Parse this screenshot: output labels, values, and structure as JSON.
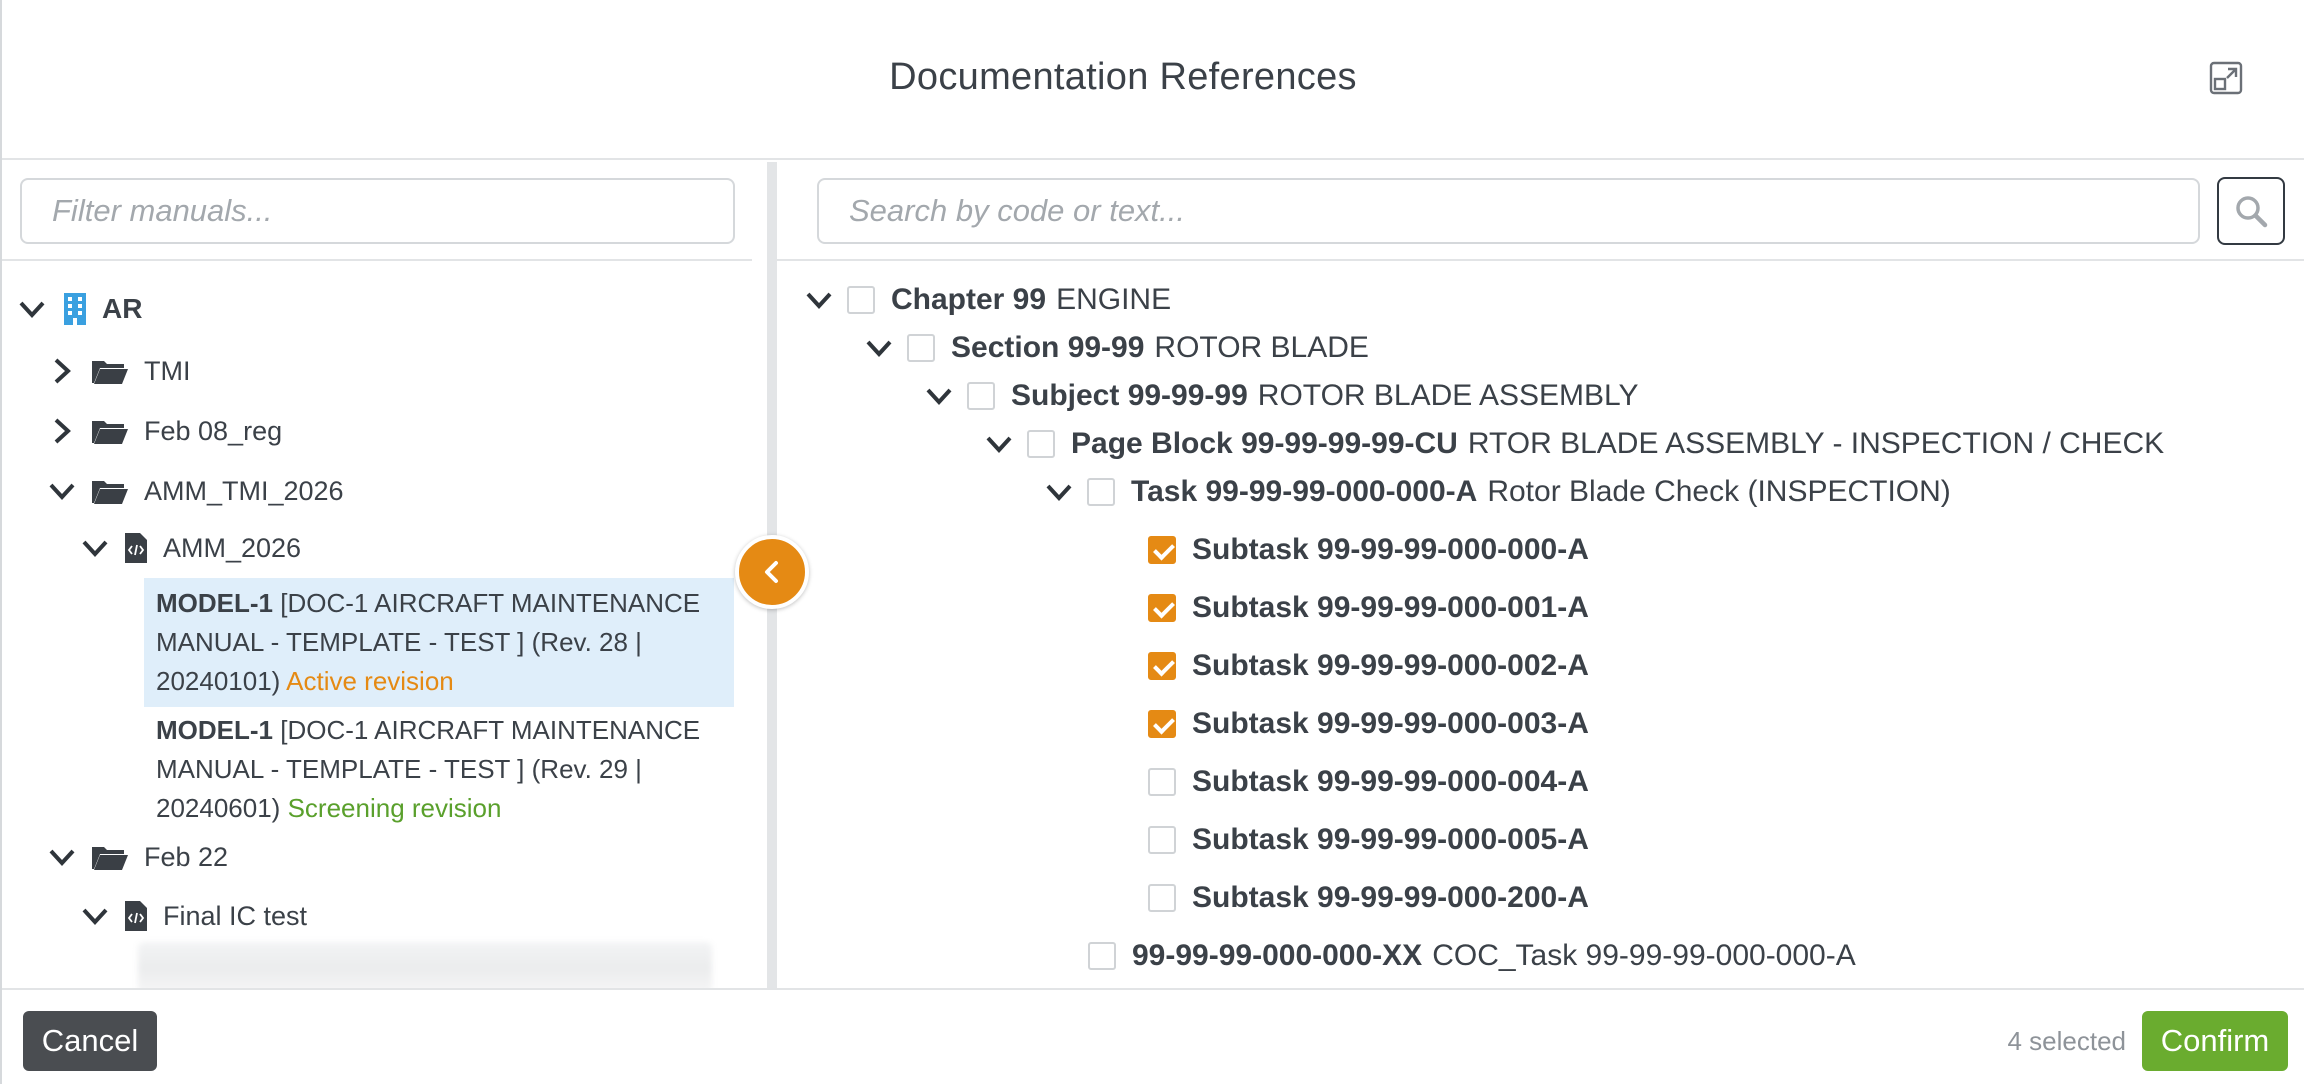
{
  "header": {
    "title": "Documentation References",
    "expand_icon": "expand-icon"
  },
  "left": {
    "filter_placeholder": "Filter manuals...",
    "tree": {
      "root": {
        "label": "AR",
        "icon": "building-icon",
        "color": "#3aa0e0"
      },
      "tmi": {
        "label": "TMI"
      },
      "feb08": {
        "label": "Feb 08_reg"
      },
      "amm_tmi": {
        "label": "AMM_TMI_2026"
      },
      "amm_2026": {
        "label": "AMM_2026"
      },
      "rev28": {
        "model": "MODEL-1",
        "title": "[DOC-1 AIRCRAFT MAINTENANCE MANUAL - TEMPLATE - TEST ] (Rev. 28 | 20240101)",
        "status": "Active revision"
      },
      "rev29": {
        "model": "MODEL-1",
        "title": "[DOC-1 AIRCRAFT MAINTENANCE MANUAL - TEMPLATE - TEST ] (Rev. 29 | 20240601)",
        "status": "Screening revision"
      },
      "feb22": {
        "label": "Feb 22"
      },
      "final_ic": {
        "label": "Final IC test"
      }
    }
  },
  "right": {
    "search_placeholder": "Search by code or text...",
    "tree": {
      "chapter": {
        "code": "Chapter 99",
        "text": "ENGINE"
      },
      "section": {
        "code": "Section 99-99",
        "text": "ROTOR BLADE"
      },
      "subject": {
        "code": "Subject 99-99-99",
        "text": "ROTOR BLADE ASSEMBLY"
      },
      "pageblock": {
        "code": "Page Block 99-99-99-99-CU",
        "text": "RTOR BLADE ASSEMBLY - INSPECTION / CHECK"
      },
      "task": {
        "code": "Task 99-99-99-000-000-A",
        "text": "Rotor Blade Check (INSPECTION)"
      },
      "subtasks": [
        {
          "code": "Subtask 99-99-99-000-000-A",
          "checked": true
        },
        {
          "code": "Subtask 99-99-99-000-001-A",
          "checked": true
        },
        {
          "code": "Subtask 99-99-99-000-002-A",
          "checked": true
        },
        {
          "code": "Subtask 99-99-99-000-003-A",
          "checked": true
        },
        {
          "code": "Subtask 99-99-99-000-004-A",
          "checked": false
        },
        {
          "code": "Subtask 99-99-99-000-005-A",
          "checked": false
        },
        {
          "code": "Subtask 99-99-99-000-200-A",
          "checked": false
        }
      ],
      "coc": {
        "code": "99-99-99-000-000-XX",
        "text": "COC_Task 99-99-99-000-000-A"
      }
    }
  },
  "footer": {
    "cancel_label": "Cancel",
    "selected_count": "4 selected",
    "confirm_label": "Confirm"
  },
  "colors": {
    "accent": "#e58a14",
    "confirm": "#6aac2f",
    "selected_row": "#dfeefa"
  }
}
